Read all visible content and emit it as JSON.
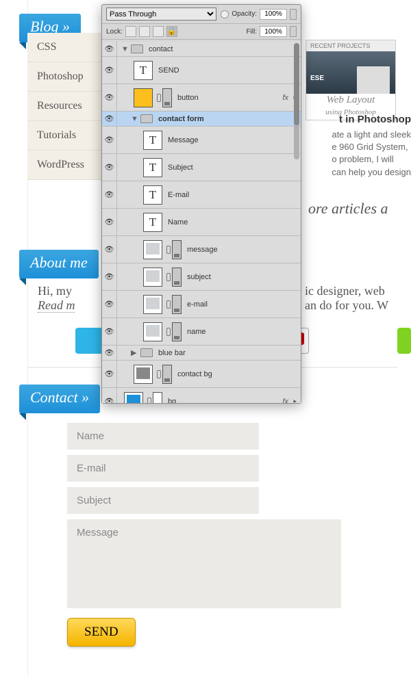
{
  "ribbons": {
    "blog": "Blog »",
    "about": "About me",
    "contact": "Contact »"
  },
  "blog_items": [
    "CSS",
    "Photoshop",
    "Resources",
    "Tutorials",
    "WordPress"
  ],
  "about_line1": "Hi, my",
  "about_line1b": "ic designer, web",
  "about_read": "Read m",
  "about_line2b": "an do for you. W",
  "more": "ore articles a",
  "proj": {
    "head": "RECENT PROJECTS",
    "ese": "ESE",
    "cap": "Web Layout",
    "cap2": "using Photoshop",
    "title": "t in Photoshop",
    "desc1": "ate a light and sleek",
    "desc2": "e 960 Grid System,",
    "desc3": "o problem, I will",
    "desc4": "can help you design"
  },
  "form": {
    "name": "Name",
    "email": "E-mail",
    "subject": "Subject",
    "message": "Message",
    "send": "SEND"
  },
  "panel": {
    "mode": "Pass Through",
    "opacity_label": "Opacity:",
    "opacity": "100%",
    "lock_label": "Lock:",
    "fill_label": "Fill:",
    "fill": "100%",
    "layers": {
      "contact": "contact",
      "send": "SEND",
      "button": "button",
      "contact_form": "contact form",
      "Message": "Message",
      "Subject": "Subject",
      "Email": "E-mail",
      "Name": "Name",
      "message": "message",
      "subject": "subject",
      "email": "e-mail",
      "name": "name",
      "blue_bar": "blue bar",
      "contact_bg": "contact bg",
      "bg": "bg",
      "fx": "fx"
    }
  }
}
